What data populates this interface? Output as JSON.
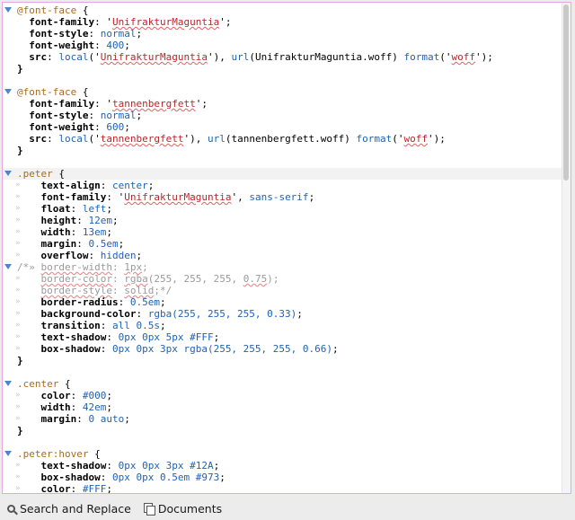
{
  "lines": [
    {
      "fold": true,
      "indent": 0,
      "tokens": [
        [
          "at",
          "@font-face"
        ],
        [
          "plain",
          " {"
        ]
      ]
    },
    {
      "indent": 1,
      "tokens": [
        [
          "kw",
          "font-family"
        ],
        [
          "plain",
          ": "
        ],
        [
          "plain",
          "'"
        ],
        [
          "str",
          "UnifrakturMaguntia"
        ],
        [
          "plain",
          "';"
        ]
      ]
    },
    {
      "indent": 1,
      "tokens": [
        [
          "kw",
          "font-style"
        ],
        [
          "plain",
          ": "
        ],
        [
          "val",
          "normal"
        ],
        [
          "plain",
          ";"
        ]
      ]
    },
    {
      "indent": 1,
      "tokens": [
        [
          "kw",
          "font-weight"
        ],
        [
          "plain",
          ": "
        ],
        [
          "val",
          "400"
        ],
        [
          "plain",
          ";"
        ]
      ]
    },
    {
      "indent": 1,
      "tokens": [
        [
          "kw",
          "src"
        ],
        [
          "plain",
          ": "
        ],
        [
          "val",
          "local"
        ],
        [
          "plain",
          "('"
        ],
        [
          "str",
          "UnifrakturMaguntia"
        ],
        [
          "plain",
          "'), "
        ],
        [
          "val",
          "url"
        ],
        [
          "plain",
          "(UnifrakturMaguntia.woff) "
        ],
        [
          "val",
          "format"
        ],
        [
          "plain",
          "('"
        ],
        [
          "str",
          "woff"
        ],
        [
          "plain",
          "');"
        ]
      ]
    },
    {
      "indent": 0,
      "tokens": [
        [
          "kw",
          "}"
        ]
      ]
    },
    {
      "indent": 0,
      "tokens": []
    },
    {
      "fold": true,
      "indent": 0,
      "tokens": [
        [
          "at",
          "@font-face"
        ],
        [
          "plain",
          " {"
        ]
      ]
    },
    {
      "indent": 1,
      "tokens": [
        [
          "kw",
          "font-family"
        ],
        [
          "plain",
          ": "
        ],
        [
          "plain",
          "'"
        ],
        [
          "str",
          "tannenbergfett"
        ],
        [
          "plain",
          "';"
        ]
      ]
    },
    {
      "indent": 1,
      "tokens": [
        [
          "kw",
          "font-style"
        ],
        [
          "plain",
          ": "
        ],
        [
          "val",
          "normal"
        ],
        [
          "plain",
          ";"
        ]
      ]
    },
    {
      "indent": 1,
      "tokens": [
        [
          "kw",
          "font-weight"
        ],
        [
          "plain",
          ": "
        ],
        [
          "val",
          "600"
        ],
        [
          "plain",
          ";"
        ]
      ]
    },
    {
      "indent": 1,
      "tokens": [
        [
          "kw",
          "src"
        ],
        [
          "plain",
          ": "
        ],
        [
          "val",
          "local"
        ],
        [
          "plain",
          "('"
        ],
        [
          "str",
          "tannenbergfett"
        ],
        [
          "plain",
          "'), "
        ],
        [
          "val",
          "url"
        ],
        [
          "plain",
          "(tannenbergfett.woff) "
        ],
        [
          "val",
          "format"
        ],
        [
          "plain",
          "('"
        ],
        [
          "str",
          "woff"
        ],
        [
          "plain",
          "');"
        ]
      ]
    },
    {
      "indent": 0,
      "tokens": [
        [
          "kw",
          "}"
        ]
      ]
    },
    {
      "indent": 0,
      "tokens": []
    },
    {
      "fold": true,
      "hl": true,
      "indent": 0,
      "tokens": [
        [
          "sel",
          ".peter"
        ],
        [
          "plain",
          " {"
        ]
      ]
    },
    {
      "mark": true,
      "indent": 2,
      "tokens": [
        [
          "kw",
          "text-align"
        ],
        [
          "plain",
          ": "
        ],
        [
          "val",
          "center"
        ],
        [
          "plain",
          ";"
        ]
      ]
    },
    {
      "mark": true,
      "indent": 2,
      "tokens": [
        [
          "kw",
          "font-family"
        ],
        [
          "plain",
          ": '"
        ],
        [
          "str",
          "UnifrakturMaguntia"
        ],
        [
          "plain",
          "', "
        ],
        [
          "val",
          "sans-serif"
        ],
        [
          "plain",
          ";"
        ]
      ]
    },
    {
      "mark": true,
      "indent": 2,
      "tokens": [
        [
          "kw",
          "float"
        ],
        [
          "plain",
          ": "
        ],
        [
          "val",
          "left"
        ],
        [
          "plain",
          ";"
        ]
      ]
    },
    {
      "mark": true,
      "indent": 2,
      "tokens": [
        [
          "kw",
          "height"
        ],
        [
          "plain",
          ": "
        ],
        [
          "val",
          "12em"
        ],
        [
          "plain",
          ";"
        ]
      ]
    },
    {
      "mark": true,
      "indent": 2,
      "tokens": [
        [
          "kw",
          "width"
        ],
        [
          "plain",
          ": "
        ],
        [
          "val",
          "13em"
        ],
        [
          "plain",
          ";"
        ]
      ]
    },
    {
      "mark": true,
      "indent": 2,
      "tokens": [
        [
          "kw",
          "margin"
        ],
        [
          "plain",
          ": "
        ],
        [
          "val",
          "0.5em"
        ],
        [
          "plain",
          ";"
        ]
      ]
    },
    {
      "mark": true,
      "indent": 2,
      "tokens": [
        [
          "kw",
          "overflow"
        ],
        [
          "plain",
          ": "
        ],
        [
          "val",
          "hidden"
        ],
        [
          "plain",
          ";"
        ]
      ]
    },
    {
      "fold": true,
      "indent": 0,
      "tokens": [
        [
          "cm",
          "/*"
        ],
        [
          "cm",
          "» "
        ],
        [
          "cm-u",
          "border-width"
        ],
        [
          "cm",
          ": "
        ],
        [
          "cm-u",
          "1px"
        ],
        [
          "cm",
          ";"
        ]
      ]
    },
    {
      "mark": true,
      "indent": 2,
      "tokens": [
        [
          "cm-u",
          "border-color"
        ],
        [
          "cm",
          ": "
        ],
        [
          "cm-u",
          "rgba"
        ],
        [
          "cm",
          "(255, 255, 255, "
        ],
        [
          "cm-u",
          "0.75"
        ],
        [
          "cm",
          ");"
        ]
      ]
    },
    {
      "mark": true,
      "indent": 2,
      "tokens": [
        [
          "cm-u",
          "border-style"
        ],
        [
          "cm",
          ": "
        ],
        [
          "cm-u",
          "solid"
        ],
        [
          "cm",
          ";*/"
        ]
      ]
    },
    {
      "mark": true,
      "indent": 2,
      "tokens": [
        [
          "kw",
          "border-radius"
        ],
        [
          "plain",
          ": "
        ],
        [
          "val",
          "0.5em"
        ],
        [
          "plain",
          ";"
        ]
      ]
    },
    {
      "mark": true,
      "indent": 2,
      "tokens": [
        [
          "kw",
          "background-color"
        ],
        [
          "plain",
          ": "
        ],
        [
          "val",
          "rgba(255, 255, 255, 0.33)"
        ],
        [
          "plain",
          ";"
        ]
      ]
    },
    {
      "mark": true,
      "indent": 2,
      "tokens": [
        [
          "kw",
          "transition"
        ],
        [
          "plain",
          ": "
        ],
        [
          "val",
          "all 0.5s"
        ],
        [
          "plain",
          ";"
        ]
      ]
    },
    {
      "mark": true,
      "indent": 2,
      "tokens": [
        [
          "kw",
          "text-shadow"
        ],
        [
          "plain",
          ": "
        ],
        [
          "val",
          "0px 0px 5px #FFF"
        ],
        [
          "plain",
          ";"
        ]
      ]
    },
    {
      "mark": true,
      "indent": 2,
      "tokens": [
        [
          "kw",
          "box-shadow"
        ],
        [
          "plain",
          ": "
        ],
        [
          "val",
          "0px 0px 3px rgba(255, 255, 255, 0.66)"
        ],
        [
          "plain",
          ";"
        ]
      ]
    },
    {
      "indent": 0,
      "tokens": [
        [
          "kw",
          "}"
        ]
      ]
    },
    {
      "indent": 0,
      "tokens": []
    },
    {
      "fold": true,
      "indent": 0,
      "tokens": [
        [
          "sel",
          ".center"
        ],
        [
          "plain",
          " {"
        ]
      ]
    },
    {
      "mark": true,
      "indent": 2,
      "tokens": [
        [
          "kw",
          "color"
        ],
        [
          "plain",
          ": "
        ],
        [
          "val",
          "#000"
        ],
        [
          "plain",
          ";"
        ]
      ]
    },
    {
      "mark": true,
      "indent": 2,
      "tokens": [
        [
          "kw",
          "width"
        ],
        [
          "plain",
          ": "
        ],
        [
          "val",
          "42em"
        ],
        [
          "plain",
          ";"
        ]
      ]
    },
    {
      "mark": true,
      "indent": 2,
      "tokens": [
        [
          "kw",
          "margin"
        ],
        [
          "plain",
          ": "
        ],
        [
          "val",
          "0 auto"
        ],
        [
          "plain",
          ";"
        ]
      ]
    },
    {
      "indent": 0,
      "tokens": [
        [
          "kw",
          "}"
        ]
      ]
    },
    {
      "indent": 0,
      "tokens": []
    },
    {
      "fold": true,
      "indent": 0,
      "tokens": [
        [
          "sel",
          ".peter:hover"
        ],
        [
          "plain",
          " {"
        ]
      ]
    },
    {
      "mark": true,
      "indent": 2,
      "tokens": [
        [
          "kw",
          "text-shadow"
        ],
        [
          "plain",
          ": "
        ],
        [
          "val",
          "0px 0px 3px #12A"
        ],
        [
          "plain",
          ";"
        ]
      ]
    },
    {
      "mark": true,
      "indent": 2,
      "tokens": [
        [
          "kw",
          "box-shadow"
        ],
        [
          "plain",
          ": "
        ],
        [
          "val",
          "0px 0px 0.5em #973"
        ],
        [
          "plain",
          ";"
        ]
      ]
    },
    {
      "mark": true,
      "indent": 2,
      "tokens": [
        [
          "kw",
          "color"
        ],
        [
          "plain",
          ": "
        ],
        [
          "val",
          "#FFF"
        ],
        [
          "plain",
          ";"
        ]
      ]
    }
  ],
  "bottombar": {
    "search_replace_label": "Search and Replace",
    "documents_label": "Documents"
  },
  "colors": {
    "keyword": "#000000",
    "selector": "#a86b1f",
    "string": "#b8262a",
    "value": "#1f62b5",
    "comment": "#9a9a9a",
    "fold_arrow": "#4a86c8",
    "editor_border": "#e2a8df"
  }
}
